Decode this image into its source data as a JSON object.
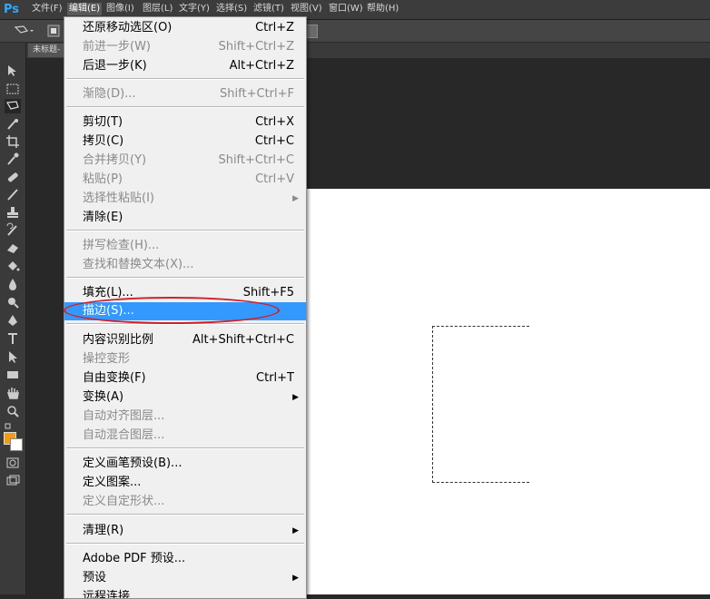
{
  "app": {
    "logo": "Ps"
  },
  "menubar": {
    "items": [
      "文件(F)",
      "编辑(E)",
      "图像(I)",
      "图层(L)",
      "文字(Y)",
      "选择(S)",
      "滤镜(T)",
      "视图(V)",
      "窗口(W)",
      "帮助(H)"
    ],
    "active_index": 1
  },
  "document_tab": {
    "label": "未标题-"
  },
  "edit_menu": {
    "items": [
      {
        "label": "还原移动选区(O)",
        "shortcut": "Ctrl+Z",
        "enabled": true
      },
      {
        "label": "前进一步(W)",
        "shortcut": "Shift+Ctrl+Z",
        "enabled": false
      },
      {
        "label": "后退一步(K)",
        "shortcut": "Alt+Ctrl+Z",
        "enabled": true
      },
      {
        "label": "渐隐(D)...",
        "shortcut": "Shift+Ctrl+F",
        "enabled": false
      },
      {
        "label": "剪切(T)",
        "shortcut": "Ctrl+X",
        "enabled": true
      },
      {
        "label": "拷贝(C)",
        "shortcut": "Ctrl+C",
        "enabled": true
      },
      {
        "label": "合并拷贝(Y)",
        "shortcut": "Shift+Ctrl+C",
        "enabled": false
      },
      {
        "label": "粘贴(P)",
        "shortcut": "Ctrl+V",
        "enabled": false
      },
      {
        "label": "选择性粘贴(I)",
        "shortcut": "",
        "enabled": false,
        "submenu": true
      },
      {
        "label": "清除(E)",
        "shortcut": "",
        "enabled": true
      },
      {
        "label": "拼写检查(H)...",
        "shortcut": "",
        "enabled": false
      },
      {
        "label": "查找和替换文本(X)...",
        "shortcut": "",
        "enabled": false
      },
      {
        "label": "填充(L)...",
        "shortcut": "Shift+F5",
        "enabled": true
      },
      {
        "label": "描边(S)...",
        "shortcut": "",
        "enabled": true,
        "highlighted": true
      },
      {
        "label": "内容识别比例",
        "shortcut": "Alt+Shift+Ctrl+C",
        "enabled": true
      },
      {
        "label": "操控变形",
        "shortcut": "",
        "enabled": false
      },
      {
        "label": "自由变换(F)",
        "shortcut": "Ctrl+T",
        "enabled": true
      },
      {
        "label": "变换(A)",
        "shortcut": "",
        "enabled": true,
        "submenu": true
      },
      {
        "label": "自动对齐图层...",
        "shortcut": "",
        "enabled": false
      },
      {
        "label": "自动混合图层...",
        "shortcut": "",
        "enabled": false
      },
      {
        "label": "定义画笔预设(B)...",
        "shortcut": "",
        "enabled": true
      },
      {
        "label": "定义图案...",
        "shortcut": "",
        "enabled": true
      },
      {
        "label": "定义自定形状...",
        "shortcut": "",
        "enabled": false
      },
      {
        "label": "清理(R)",
        "shortcut": "",
        "enabled": true,
        "submenu": true
      },
      {
        "label": "Adobe PDF 预设...",
        "shortcut": "",
        "enabled": true
      },
      {
        "label": "预设",
        "shortcut": "",
        "enabled": true,
        "submenu": true
      },
      {
        "label": "远程连接...",
        "shortcut": "",
        "enabled": true
      }
    ]
  },
  "colors": {
    "highlight": "#3399ff",
    "annotation_ellipse": "#d0202a",
    "foreground_color": "#f39c12",
    "background_color": "#ffffff"
  },
  "tools": [
    "move-tool-icon",
    "marquee-tool-icon",
    "lasso-tool-icon",
    "quick-select-tool-icon",
    "crop-tool-icon",
    "eyedropper-tool-icon",
    "healing-brush-tool-icon",
    "brush-tool-icon",
    "clone-stamp-tool-icon",
    "history-brush-tool-icon",
    "eraser-tool-icon",
    "paint-bucket-tool-icon",
    "blur-tool-icon",
    "dodge-tool-icon",
    "pen-tool-icon",
    "type-tool-icon",
    "path-select-tool-icon",
    "shape-tool-icon",
    "hand-tool-icon",
    "zoom-tool-icon"
  ]
}
